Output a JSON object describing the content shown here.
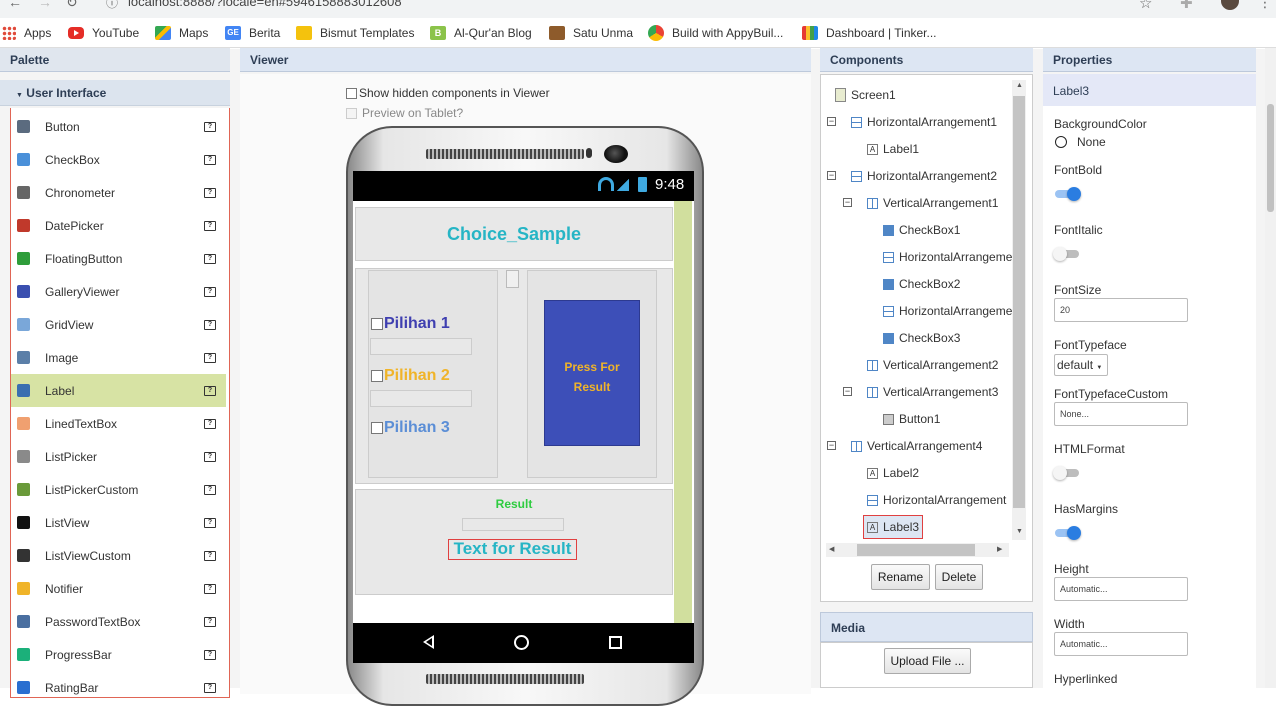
{
  "browser": {
    "url": "localhost:8888/?locale=en#5946158883012608",
    "bookmarks": [
      "Apps",
      "YouTube",
      "Maps",
      "Berita",
      "Bismut Templates",
      "Al-Qur'an Blog",
      "Satu Unma",
      "Build with AppyBuil...",
      "Dashboard | Tinker..."
    ]
  },
  "palette": {
    "title": "Palette",
    "category": "User Interface",
    "items": [
      "Button",
      "CheckBox",
      "Chronometer",
      "DatePicker",
      "FloatingButton",
      "GalleryViewer",
      "GridView",
      "Image",
      "Label",
      "LinedTextBox",
      "ListPicker",
      "ListPickerCustom",
      "ListView",
      "ListViewCustom",
      "Notifier",
      "PasswordTextBox",
      "ProgressBar",
      "RatingBar"
    ],
    "selected": "Label"
  },
  "viewer": {
    "title": "Viewer",
    "show_hidden": "Show hidden components in Viewer",
    "preview_tablet": "Preview on Tablet?",
    "phone": {
      "time": "9:48",
      "app_title": "Choice_Sample",
      "checks": [
        {
          "label": "Pilihan 1",
          "color": "#3f3fb0"
        },
        {
          "label": "Pilihan 2",
          "color": "#f0b429"
        },
        {
          "label": "Pilihan 3",
          "color": "#5b8ed6"
        }
      ],
      "button_text_1": "Press For",
      "button_text_2": "Result",
      "result_label": "Result",
      "result_text": "Text for Result"
    }
  },
  "components": {
    "title": "Components",
    "tree": [
      {
        "label": "Screen1"
      },
      {
        "label": "HorizontalArrangement1"
      },
      {
        "label": "Label1"
      },
      {
        "label": "HorizontalArrangement2"
      },
      {
        "label": "VerticalArrangement1"
      },
      {
        "label": "CheckBox1"
      },
      {
        "label": "HorizontalArrangeme"
      },
      {
        "label": "CheckBox2"
      },
      {
        "label": "HorizontalArrangeme"
      },
      {
        "label": "CheckBox3"
      },
      {
        "label": "VerticalArrangement2"
      },
      {
        "label": "VerticalArrangement3"
      },
      {
        "label": "Button1"
      },
      {
        "label": "VerticalArrangement4"
      },
      {
        "label": "Label2"
      },
      {
        "label": "HorizontalArrangement"
      },
      {
        "label": "Label3"
      }
    ],
    "rename": "Rename",
    "delete": "Delete"
  },
  "media": {
    "title": "Media",
    "upload": "Upload File ..."
  },
  "properties": {
    "title": "Properties",
    "component": "Label3",
    "background_color_label": "BackgroundColor",
    "background_color_value": "None",
    "font_bold_label": "FontBold",
    "font_italic_label": "FontItalic",
    "font_size_label": "FontSize",
    "font_size_value": "20",
    "font_typeface_label": "FontTypeface",
    "font_typeface_value": "default",
    "font_typeface_custom_label": "FontTypefaceCustom",
    "font_typeface_custom_value": "None...",
    "html_format_label": "HTMLFormat",
    "has_margins_label": "HasMargins",
    "height_label": "Height",
    "height_value": "Automatic...",
    "width_label": "Width",
    "width_value": "Automatic...",
    "hyperlinked_label": "Hyperlinked"
  },
  "colors": {
    "accent": "#2a7de1",
    "panel_header": "#dde6f3",
    "selected_palette": "#d7e3a4",
    "phone_button": "#3d4fb8"
  }
}
